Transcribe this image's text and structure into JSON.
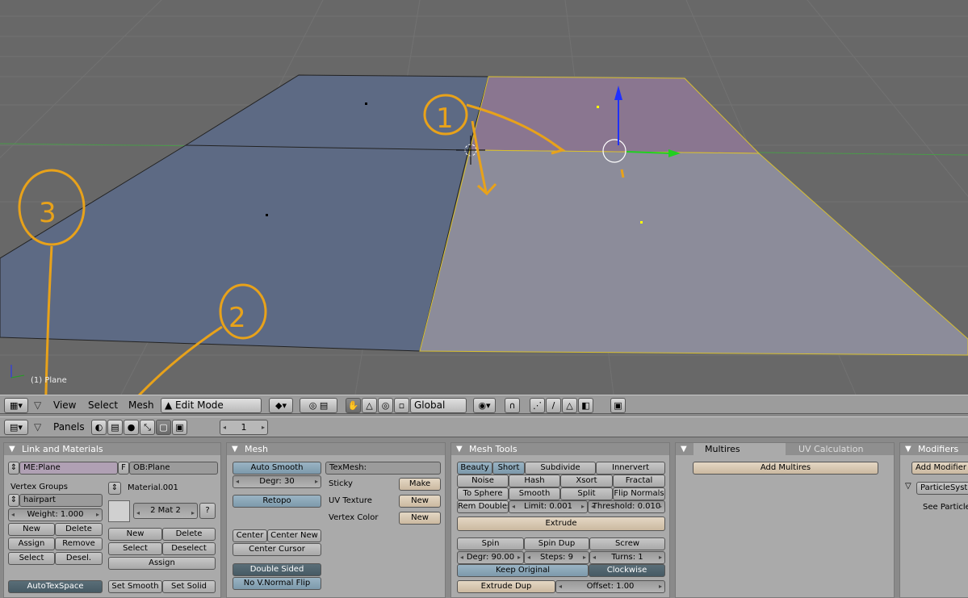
{
  "viewport": {
    "object_label": "(1) Plane",
    "annotations": [
      "1",
      "2",
      "3"
    ]
  },
  "header3d": {
    "menus": [
      "View",
      "Select",
      "Mesh"
    ],
    "mode": "Edit Mode",
    "orientation": "Global"
  },
  "buttons_header": {
    "panels_label": "Panels",
    "frame": "1"
  },
  "link_materials": {
    "title": "Link and Materials",
    "mesh_name": "ME:Plane",
    "f_label": "F",
    "object_name": "OB:Plane",
    "vertex_groups_label": "Vertex Groups",
    "vertex_group": "hairpart",
    "weight": "Weight: 1.000",
    "vg_new": "New",
    "vg_delete": "Delete",
    "vg_assign": "Assign",
    "vg_remove": "Remove",
    "vg_select": "Select",
    "vg_desel": "Desel.",
    "material_name": "Material.001",
    "mat_index": "2 Mat 2",
    "mat_help": "?",
    "mat_new": "New",
    "mat_delete": "Delete",
    "mat_select": "Select",
    "mat_deselect": "Deselect",
    "mat_assign": "Assign",
    "autotexspace": "AutoTexSpace",
    "set_smooth": "Set Smooth",
    "set_solid": "Set Solid"
  },
  "mesh": {
    "title": "Mesh",
    "auto_smooth": "Auto Smooth",
    "degr": "Degr: 30",
    "retopo": "Retopo",
    "texmesh": "TexMesh:",
    "sticky": "Sticky",
    "make": "Make",
    "uv_texture": "UV Texture",
    "uv_new": "New",
    "vertex_color": "Vertex Color",
    "vc_new": "New",
    "center": "Center",
    "center_new": "Center New",
    "center_cursor": "Center Cursor",
    "double_sided": "Double Sided",
    "no_vnormal_flip": "No V.Normal Flip"
  },
  "mesh_tools": {
    "title": "Mesh Tools",
    "beauty": "Beauty",
    "short": "Short",
    "subdivide": "Subdivide",
    "innervert": "Innervert",
    "noise": "Noise",
    "hash": "Hash",
    "xsort": "Xsort",
    "fractal": "Fractal",
    "to_sphere": "To Sphere",
    "smooth": "Smooth",
    "split": "Split",
    "flip_normals": "Flip Normals",
    "rem_doubles": "Rem Doubles",
    "limit": "Limit: 0.001",
    "threshold": "Threshold: 0.010",
    "extrude": "Extrude",
    "spin": "Spin",
    "spin_dup": "Spin Dup",
    "screw": "Screw",
    "degr": "Degr: 90.00",
    "steps": "Steps: 9",
    "turns": "Turns: 1",
    "keep_original": "Keep Original",
    "clockwise": "Clockwise",
    "extrude_dup": "Extrude Dup",
    "offset": "Offset: 1.00"
  },
  "multires": {
    "tab1": "Multires",
    "tab2": "UV Calculation",
    "add_multires": "Add Multires"
  },
  "modifiers": {
    "title": "Modifiers",
    "add_modifier": "Add Modifier",
    "particle_system": "ParticleSystem",
    "see_particle": "See Particle"
  },
  "colors": {
    "viewport_bg": "#686868",
    "face_blue": "#5d6a84",
    "face_pink": "#8a7690",
    "annotation": "#e8a21a"
  }
}
